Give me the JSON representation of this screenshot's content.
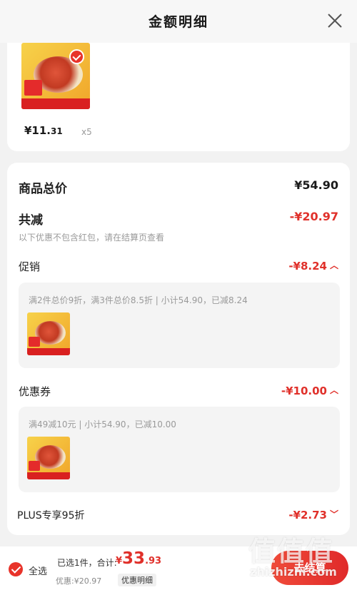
{
  "header": {
    "title": "金额明细",
    "close_icon": "close-icon"
  },
  "product": {
    "price_int": "¥11.",
    "price_dec": "31",
    "qty": "x5"
  },
  "detail": {
    "goods_total_label": "商品总价",
    "goods_total_value": "¥54.90",
    "total_discount_label": "共减",
    "total_discount_value": "-¥20.97",
    "discount_note": "以下优惠不包含红包，请在结算页查看",
    "promo_label": "促销",
    "promo_value": "-¥8.24",
    "promo_desc": "满2件总价9折，满3件总价8.5折 | 小计54.90，已减8.24",
    "coupon_label": "优惠券",
    "coupon_value": "-¥10.00",
    "coupon_desc": "满49减10元 | 小计54.90，已减10.00",
    "plus_label": "PLUS专享95折",
    "plus_value": "-¥2.73"
  },
  "bottom_bar": {
    "select_all": "全选",
    "summary": "已选1件，合计:",
    "total_cur": "¥",
    "total_int": "33",
    "total_dec": ".93",
    "discount_text": "优惠:¥20.97",
    "detail_button": "优惠明细",
    "checkout_button": "去结算"
  },
  "watermark": {
    "logo": "值值值",
    "text": "zhizhizhi.com"
  },
  "colors": {
    "accent": "#e0302a",
    "background": "#f2f2f2"
  }
}
